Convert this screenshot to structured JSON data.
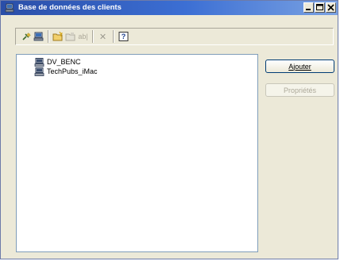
{
  "window": {
    "title": "Base de données des clients",
    "controls": {
      "minimize": "minimize-icon",
      "maximize": "maximize-icon",
      "close": "close-icon"
    }
  },
  "toolbar": {
    "tools": [
      {
        "name": "connect-icon",
        "enabled": true
      },
      {
        "name": "client-database-icon",
        "enabled": true
      },
      {
        "name": "new-folder-icon",
        "enabled": true
      },
      {
        "name": "folder-properties-icon",
        "enabled": false
      },
      {
        "name": "rename-icon",
        "label": "ab|",
        "enabled": false
      },
      {
        "name": "delete-icon",
        "label": "✕",
        "enabled": false
      },
      {
        "name": "help-icon",
        "label": "?",
        "enabled": true
      }
    ]
  },
  "clients": [
    {
      "label": "DV_BENC",
      "icon": "computer-icon"
    },
    {
      "label": "TechPubs_iMac",
      "icon": "computer-icon"
    }
  ],
  "buttons": {
    "add": "Ajouter",
    "properties": "Propriétés"
  },
  "colors": {
    "titlebar_start": "#2a4ea8",
    "titlebar_end": "#7aa2e2",
    "window_bg": "#ece9d8",
    "disabled_text": "#aca899"
  }
}
